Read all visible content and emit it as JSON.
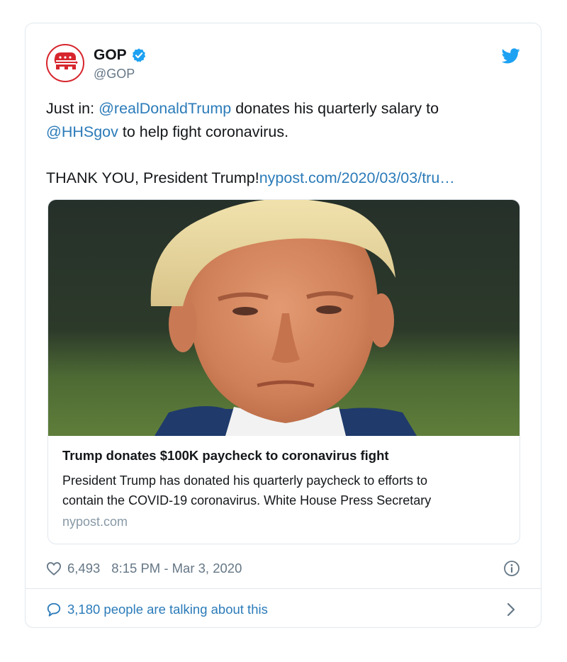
{
  "author": {
    "name": "GOP",
    "handle": "@GOP",
    "verified": true
  },
  "tweet": {
    "line1_prefix": "Just in: ",
    "mention1": "@realDonaldTrump",
    "line1_suffix": " donates his quarterly salary to",
    "mention2": "@HHSgov",
    "line2_suffix": " to help fight coronavirus.",
    "line3_text": "THANK YOU, President Trump!",
    "line3_link": "nypost.com/2020/03/03/tru…"
  },
  "card": {
    "title": "Trump donates $100K paycheck to coronavirus fight",
    "description_line1": "President Trump has donated his quarterly paycheck to efforts to",
    "description_line2": "contain the COVID-19 coronavirus. White House Press Secretary",
    "domain": "nypost.com"
  },
  "footer": {
    "likes": "6,493",
    "timestamp": "8:15 PM - Mar 3, 2020"
  },
  "conversation": {
    "label": "3,180 people are talking about this"
  },
  "colors": {
    "link": "#2b7bb9",
    "verified": "#1da1f2",
    "gop_red": "#d7262d",
    "muted": "#657786",
    "border": "#e1e8ed"
  },
  "icons": {
    "avatar": "gop-elephant-logo",
    "verified": "verified-badge-icon",
    "brand": "twitter-bird-icon",
    "like": "heart-icon",
    "info": "info-icon",
    "reply": "speech-bubble-icon",
    "more": "chevron-right-icon"
  }
}
